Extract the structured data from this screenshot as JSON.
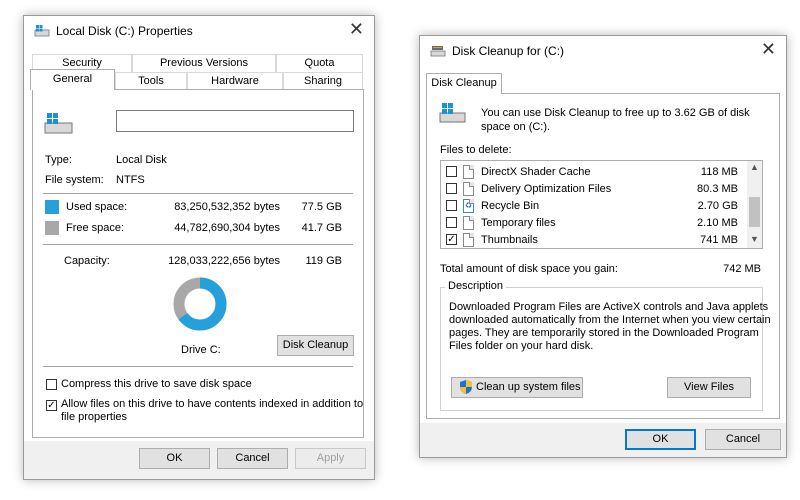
{
  "colors": {
    "used": "#26a0da",
    "free": "#a8a8a8",
    "accent": "#0078d7"
  },
  "properties": {
    "title": "Local Disk (C:) Properties",
    "close_glyph": "✕",
    "tabs_row1": [
      "Security",
      "Previous Versions",
      "Quota"
    ],
    "tabs_row2": [
      "General",
      "Tools",
      "Hardware",
      "Sharing"
    ],
    "name_value": "",
    "type_label": "Type:",
    "type_value": "Local Disk",
    "fs_label": "File system:",
    "fs_value": "NTFS",
    "used_label": "Used space:",
    "used_bytes": "83,250,532,352 bytes",
    "used_gb": "77.5 GB",
    "free_label": "Free space:",
    "free_bytes": "44,782,690,304 bytes",
    "free_gb": "41.7 GB",
    "capacity_label": "Capacity:",
    "capacity_bytes": "128,033,222,656 bytes",
    "capacity_gb": "119 GB",
    "used_fraction": 0.65,
    "drive_label": "Drive C:",
    "disk_cleanup_button": "Disk Cleanup",
    "compress_label": "Compress this drive to save disk space",
    "compress_checked": false,
    "index_label_line1": "Allow files on this drive to have contents indexed in addition to",
    "index_label_line2": "file properties",
    "index_checked": true,
    "ok": "OK",
    "cancel": "Cancel",
    "apply": "Apply"
  },
  "cleanup": {
    "title": "Disk Cleanup for  (C:)",
    "close_glyph": "✕",
    "tab": "Disk Cleanup",
    "intro_line1": "You can use Disk Cleanup to free up to 3.62 GB of disk",
    "intro_line2": "space on  (C:).",
    "files_to_delete_label": "Files to delete:",
    "files": [
      {
        "name": "DirectX Shader Cache",
        "size": "118 MB",
        "checked": false
      },
      {
        "name": "Delivery Optimization Files",
        "size": "80.3 MB",
        "checked": false
      },
      {
        "name": "Recycle Bin",
        "size": "2.70 GB",
        "checked": false
      },
      {
        "name": "Temporary files",
        "size": "2.10 MB",
        "checked": false
      },
      {
        "name": "Thumbnails",
        "size": "741 MB",
        "checked": true
      }
    ],
    "total_label": "Total amount of disk space you gain:",
    "total_value": "742 MB",
    "description_title": "Description",
    "description_lines": [
      "Downloaded Program Files are ActiveX controls and Java applets",
      "downloaded automatically from the Internet when you view certain",
      "pages. They are temporarily stored in the Downloaded Program",
      "Files folder on your hard disk."
    ],
    "clean_system_button": "Clean up system files",
    "view_files_button": "View Files",
    "ok": "OK",
    "cancel": "Cancel"
  }
}
